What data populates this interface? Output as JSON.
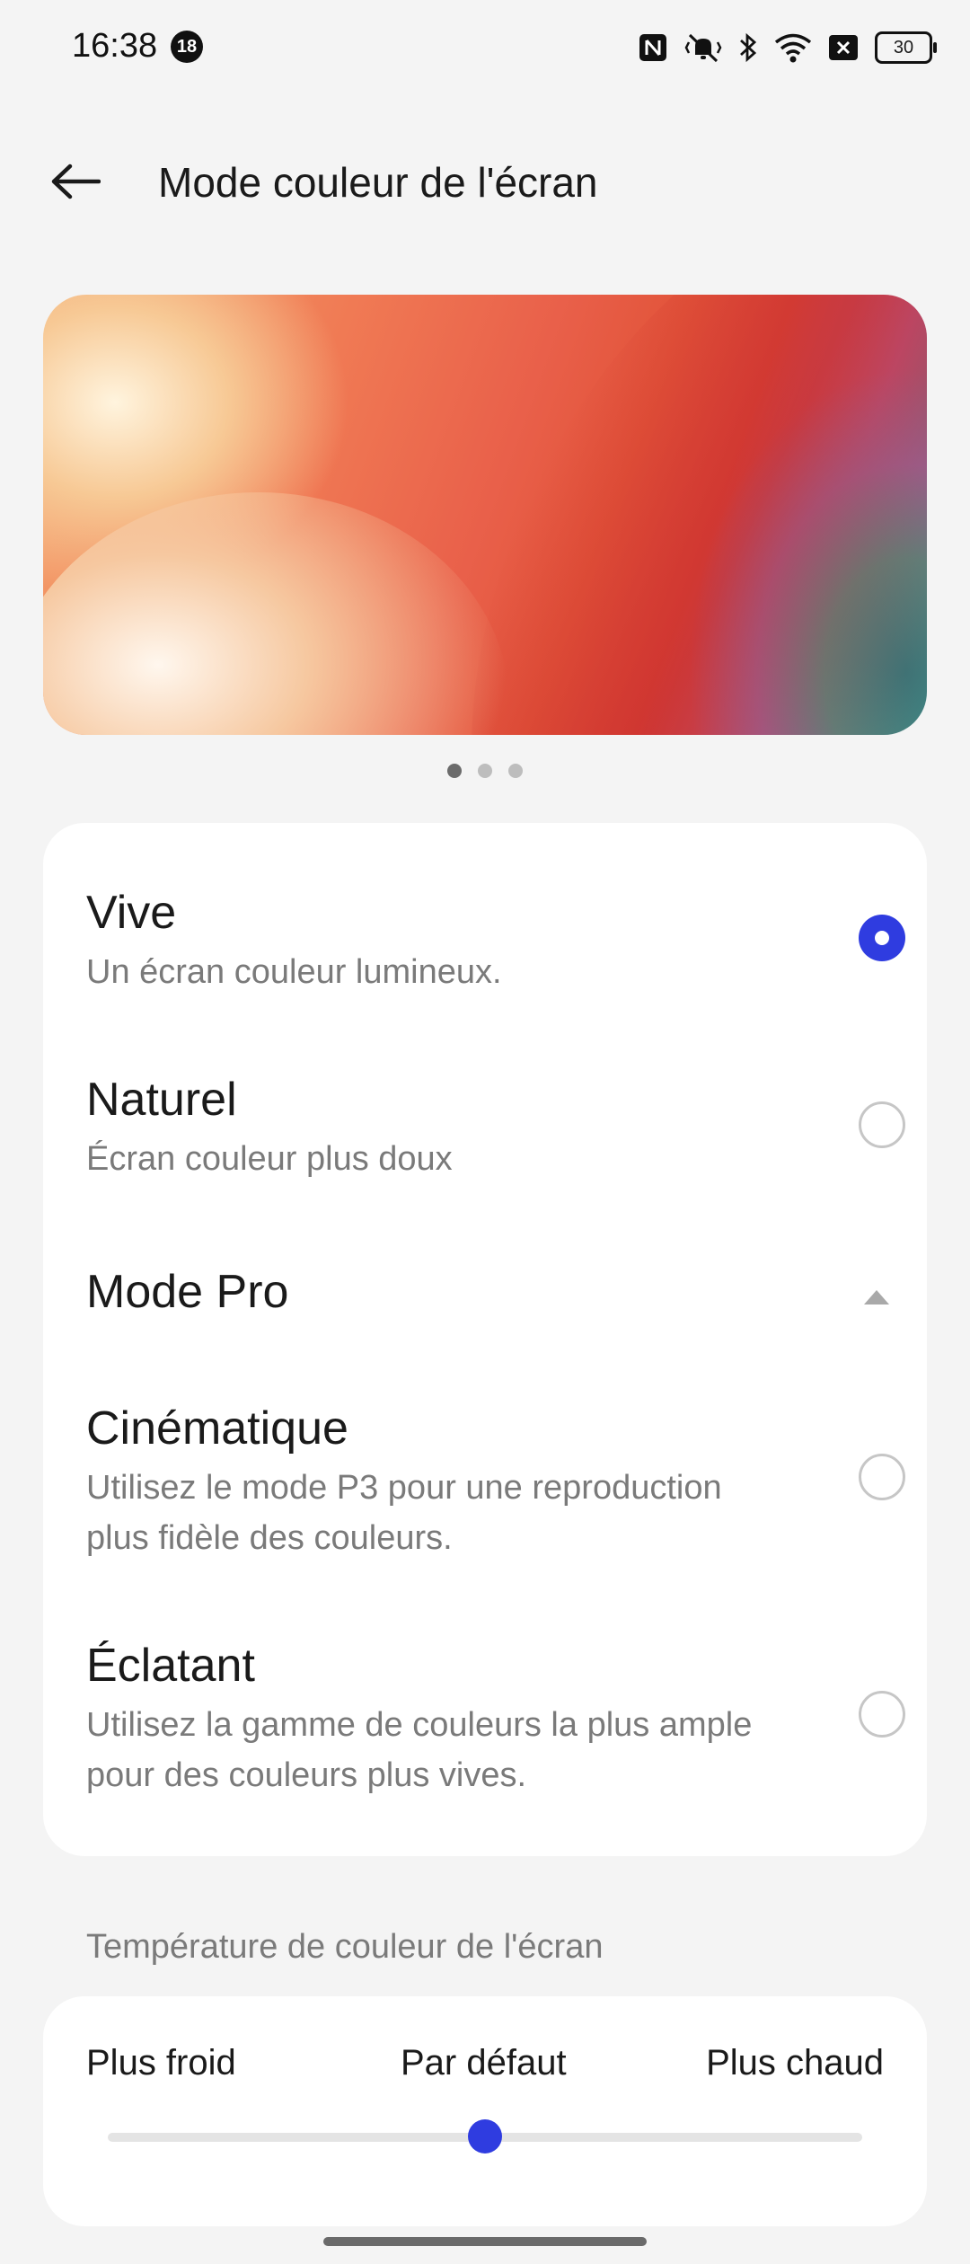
{
  "status_bar": {
    "time": "16:38",
    "notification_count": "18",
    "battery": "30",
    "icons": [
      "nfc-icon",
      "vibrate-off-icon",
      "bluetooth-icon",
      "wifi-icon",
      "no-sim-icon",
      "battery-icon"
    ]
  },
  "header": {
    "title": "Mode couleur de l'écran",
    "back_icon": "arrow-left-icon"
  },
  "carousel": {
    "page_count": 3,
    "active_index": 0
  },
  "modes": {
    "vive": {
      "title": "Vive",
      "desc": "Un écran couleur lumineux.",
      "selected": true
    },
    "naturel": {
      "title": "Naturel",
      "desc": "Écran couleur plus doux",
      "selected": false
    },
    "pro": {
      "title": "Mode Pro",
      "expanded": true
    },
    "cinematique": {
      "title": "Cinématique",
      "desc": "Utilisez le mode P3 pour une reproduction plus fidèle des couleurs.",
      "selected": false
    },
    "eclatant": {
      "title": "Éclatant",
      "desc": "Utilisez la gamme de couleurs la plus ample pour des couleurs plus vives.",
      "selected": false
    }
  },
  "temperature": {
    "section_label": "Température de couleur de l'écran",
    "cold_label": "Plus froid",
    "default_label": "Par défaut",
    "warm_label": "Plus chaud",
    "value_fraction": 0.5
  },
  "colors": {
    "accent": "#2f3ce0",
    "background": "#f4f4f4",
    "card": "#ffffff"
  }
}
